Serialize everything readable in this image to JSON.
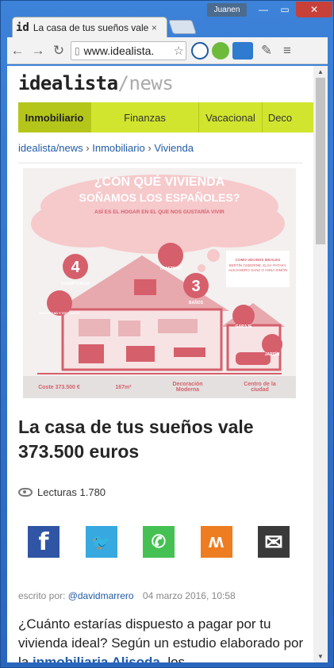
{
  "browser": {
    "tab_favicon": "id",
    "tab_title": "La casa de tus sueños vale",
    "tab_close": "×",
    "user": "Juanen",
    "url": "www.idealista.",
    "win_min": "—",
    "win_max": "▭",
    "win_close": "✕"
  },
  "site": {
    "logo_main": "idealista",
    "logo_slash": "/",
    "logo_news": "news",
    "nav": [
      "Inmobiliario",
      "Finanzas",
      "Vacacional",
      "Deco"
    ],
    "breadcrumb": [
      "idealista/news",
      "Inmobiliario",
      "Vivienda"
    ],
    "breadcrumb_sep": "›"
  },
  "infographic": {
    "headline1": "¿CON QUÉ VIVIENDA",
    "headline2": "SOÑAMOS LOS ESPAÑOLES?",
    "subhead": "ASÍ ES EL HOGAR EN EL QUE NOS GUSTARÍA VIVIR",
    "dorm_num": "4",
    "dorm_label": "DORMITORIOS",
    "trastero": "TRASTERO",
    "banos_num": "3",
    "banos_label": "BAÑOS",
    "security": "SEGURIDAD Y VIGILANCIA",
    "garaje": "GARAJE",
    "jardin": "JARDÍN",
    "neighbors_title": "COMO VECINOS IDEALES",
    "neighbors_names": "BERTÍN OSBORNE, ELSA PATAKY, ALEJANDRO SANZ O ANNA SIMÓN",
    "footer": [
      "Coste 373.500 €",
      "167m²",
      "Decoración Moderna",
      "Centro de la ciudad"
    ],
    "accent": "#d65f6c",
    "cloud": "#f6c9cb"
  },
  "article": {
    "title": "La casa de tus sueños vale 373.500 euros",
    "reads_label": "Lecturas",
    "reads_count": "1.780",
    "share": [
      {
        "name": "facebook",
        "color": "#2f55a4",
        "glyph": "f"
      },
      {
        "name": "twitter",
        "color": "#37a9e0",
        "glyph": "🐦"
      },
      {
        "name": "whatsapp",
        "color": "#45c153",
        "glyph": "✆"
      },
      {
        "name": "meneame",
        "color": "#ee7d21",
        "glyph": "ʍ"
      },
      {
        "name": "email",
        "color": "#3a3a3a",
        "glyph": "✉"
      }
    ],
    "byline_prefix": "escrito por:",
    "author": "@davidmarrero",
    "date": "04 marzo 2016, 10:58",
    "body_1": "¿Cuánto estarías dispuesto a pagar por tu vivienda ideal? Según un estudio elaborado por la ",
    "body_link": "inmobiliaria Alisoda",
    "body_2": ", los"
  },
  "colors": {
    "nav_bg": "#d1e52f",
    "link": "#225aa5"
  }
}
